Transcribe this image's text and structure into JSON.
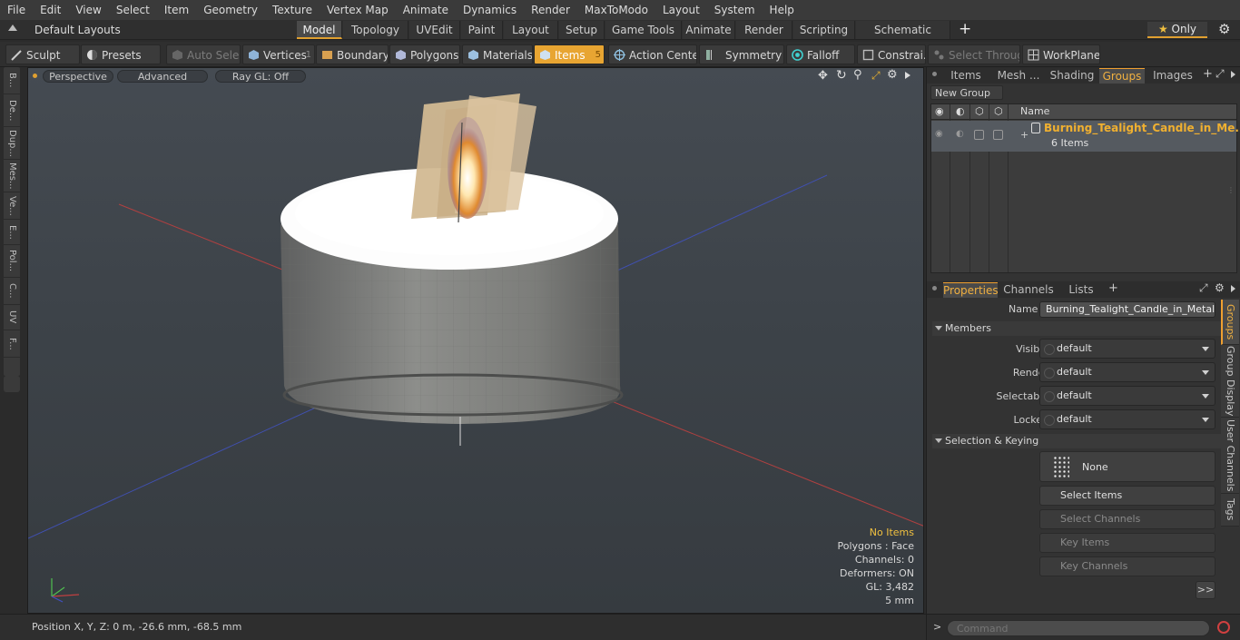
{
  "menu": [
    "File",
    "Edit",
    "View",
    "Select",
    "Item",
    "Geometry",
    "Texture",
    "Vertex Map",
    "Animate",
    "Dynamics",
    "Render",
    "MaxToModo",
    "Layout",
    "System",
    "Help"
  ],
  "layout": {
    "preset": "Default Layouts",
    "tabs": [
      "Model",
      "Topology",
      "UVEdit",
      "Paint",
      "Setup",
      "Game Tools",
      "Animate",
      "Render",
      "Scripting",
      "Schematic Fusion"
    ],
    "add": "+",
    "only": "Only"
  },
  "toolbar": {
    "sculpt": "Sculpt",
    "presets": "Presets",
    "auto_select": "Auto Select",
    "vertices": "Vertices",
    "vertices_count": "1",
    "boundary": "Boundary",
    "polygons": "Polygons",
    "materials": "Materials",
    "items": "Items",
    "items_count": "5",
    "action_center": "Action Center",
    "symmetry": "Symmetry",
    "falloff": "Falloff",
    "constraints": "Constrai...",
    "select_through": "Select Through",
    "workplane": "WorkPlane"
  },
  "left_strip": [
    "B...",
    "De...",
    "Dup...",
    "Mes...",
    "Ve...",
    "E...",
    "Pol...",
    "C...",
    "UV",
    "F..."
  ],
  "viewport": {
    "view": "Perspective",
    "mode": "Advanced",
    "raygl": "Ray GL: Off",
    "info": {
      "items": "No Items",
      "polygons": "Polygons : Face",
      "channels": "Channels: 0",
      "deformers": "Deformers: ON",
      "gl": "GL: 3,482",
      "scale": "5 mm"
    }
  },
  "status": {
    "position": "Position X, Y, Z:   0 m, -26.6 mm, -68.5 mm"
  },
  "groups_panel": {
    "tabs": [
      "Items",
      "Mesh ...",
      "Shading",
      "Groups",
      "Images"
    ],
    "new_group": "New Group",
    "col_name": "Name",
    "group_name": "Burning_Tealight_Candle_in_Me...",
    "group_count": "6 Items"
  },
  "properties": {
    "tabs": [
      "Properties",
      "Channels",
      "Lists"
    ],
    "name_label": "Name",
    "name_value": "Burning_Tealight_Candle_in_Metal_Cu",
    "members_section": "Members",
    "visible_label": "Visible",
    "visible_value": "default",
    "render_label": "Render",
    "render_value": "default",
    "selectable_label": "Selectable",
    "selectable_value": "default",
    "locked_label": "Locked",
    "locked_value": "default",
    "keying_section": "Selection & Keying",
    "none_btn": "None",
    "select_items": "Select Items",
    "select_channels": "Select Channels",
    "key_items": "Key Items",
    "key_channels": "Key Channels",
    "more": ">>",
    "side_tabs": [
      "Groups",
      "Group Display",
      "User Channels",
      "Tags"
    ]
  },
  "command": {
    "prompt": ">",
    "placeholder": "Command"
  }
}
